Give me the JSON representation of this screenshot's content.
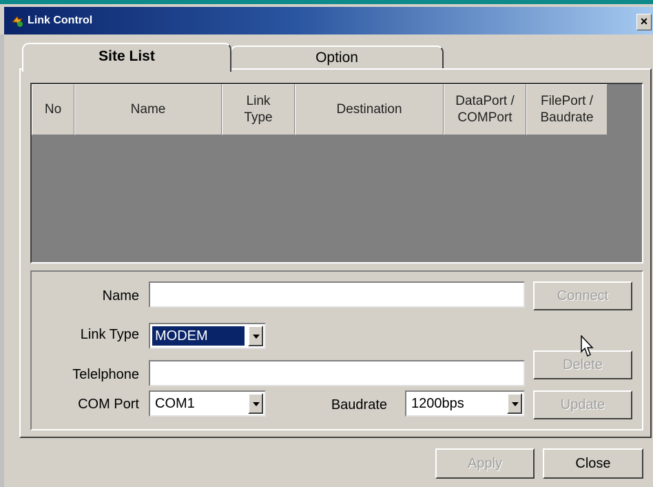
{
  "window": {
    "title": "Link Control",
    "close_glyph": "×"
  },
  "tabs": [
    {
      "label": "Site List",
      "active": true
    },
    {
      "label": "Option",
      "active": false
    }
  ],
  "grid": {
    "columns": [
      "No",
      "Name",
      "Link\nType",
      "Destination",
      "DataPort /\nCOMPort",
      "FilePort /\nBaudrate"
    ],
    "rows": []
  },
  "form": {
    "name_label": "Name",
    "name_value": "",
    "link_type_label": "Link Type",
    "link_type_value": "MODEM",
    "telephone_label": "Telelphone",
    "telephone_value": "",
    "com_port_label": "COM Port",
    "com_port_value": "COM1",
    "baudrate_label": "Baudrate",
    "baudrate_value": "1200bps"
  },
  "buttons": {
    "connect": "Connect",
    "delete": "Delete",
    "update": "Update",
    "apply": "Apply",
    "close": "Close"
  },
  "colors": {
    "titlebar_start": "#0a246a",
    "titlebar_end": "#a6caf0",
    "face": "#d4d0c8",
    "grid_bg": "#808080"
  }
}
